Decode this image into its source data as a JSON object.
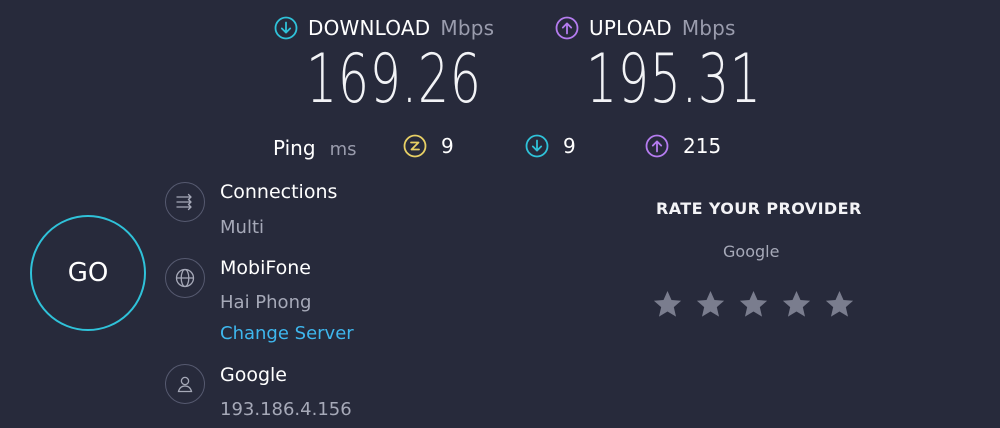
{
  "colors": {
    "background": "#272a3b",
    "download_accent": "#2fc2d9",
    "upload_accent": "#b57cf0",
    "ping_accent": "#e8d065",
    "link": "#3eb7ee",
    "star": "#7a7d8e"
  },
  "download": {
    "label": "DOWNLOAD",
    "unit": "Mbps",
    "value": "169.26",
    "icon": "download-arrow-icon"
  },
  "upload": {
    "label": "UPLOAD",
    "unit": "Mbps",
    "value": "195.31",
    "icon": "upload-arrow-icon"
  },
  "ping": {
    "label": "Ping",
    "unit": "ms",
    "idle": "9",
    "download": "9",
    "upload": "215"
  },
  "go_label": "GO",
  "connections": {
    "title": "Connections",
    "value": "Multi",
    "icon": "connections-icon"
  },
  "server": {
    "name": "MobiFone",
    "location": "Hai Phong",
    "change_label": "Change Server",
    "icon": "globe-icon"
  },
  "provider": {
    "name": "Google",
    "ip": "193.186.4.156",
    "icon": "user-icon"
  },
  "rate": {
    "title": "RATE YOUR PROVIDER",
    "provider": "Google",
    "stars": 5,
    "rating": 0
  }
}
